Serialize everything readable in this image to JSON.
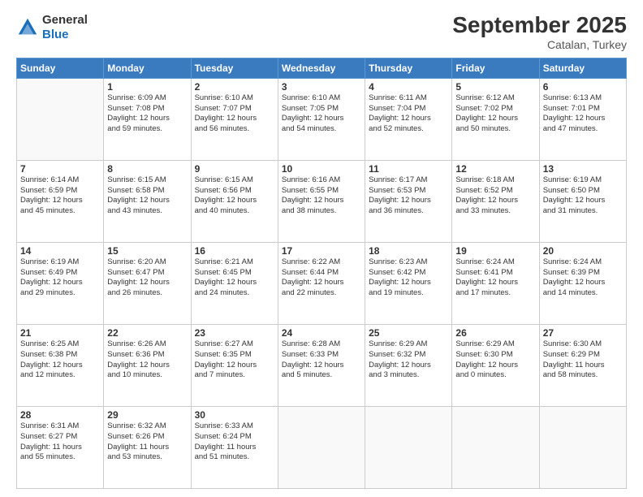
{
  "logo": {
    "general": "General",
    "blue": "Blue"
  },
  "header": {
    "month": "September 2025",
    "location": "Catalan, Turkey"
  },
  "weekdays": [
    "Sunday",
    "Monday",
    "Tuesday",
    "Wednesday",
    "Thursday",
    "Friday",
    "Saturday"
  ],
  "weeks": [
    [
      {
        "day": null,
        "info": null
      },
      {
        "day": "1",
        "info": "Sunrise: 6:09 AM\nSunset: 7:08 PM\nDaylight: 12 hours\nand 59 minutes."
      },
      {
        "day": "2",
        "info": "Sunrise: 6:10 AM\nSunset: 7:07 PM\nDaylight: 12 hours\nand 56 minutes."
      },
      {
        "day": "3",
        "info": "Sunrise: 6:10 AM\nSunset: 7:05 PM\nDaylight: 12 hours\nand 54 minutes."
      },
      {
        "day": "4",
        "info": "Sunrise: 6:11 AM\nSunset: 7:04 PM\nDaylight: 12 hours\nand 52 minutes."
      },
      {
        "day": "5",
        "info": "Sunrise: 6:12 AM\nSunset: 7:02 PM\nDaylight: 12 hours\nand 50 minutes."
      },
      {
        "day": "6",
        "info": "Sunrise: 6:13 AM\nSunset: 7:01 PM\nDaylight: 12 hours\nand 47 minutes."
      }
    ],
    [
      {
        "day": "7",
        "info": "Sunrise: 6:14 AM\nSunset: 6:59 PM\nDaylight: 12 hours\nand 45 minutes."
      },
      {
        "day": "8",
        "info": "Sunrise: 6:15 AM\nSunset: 6:58 PM\nDaylight: 12 hours\nand 43 minutes."
      },
      {
        "day": "9",
        "info": "Sunrise: 6:15 AM\nSunset: 6:56 PM\nDaylight: 12 hours\nand 40 minutes."
      },
      {
        "day": "10",
        "info": "Sunrise: 6:16 AM\nSunset: 6:55 PM\nDaylight: 12 hours\nand 38 minutes."
      },
      {
        "day": "11",
        "info": "Sunrise: 6:17 AM\nSunset: 6:53 PM\nDaylight: 12 hours\nand 36 minutes."
      },
      {
        "day": "12",
        "info": "Sunrise: 6:18 AM\nSunset: 6:52 PM\nDaylight: 12 hours\nand 33 minutes."
      },
      {
        "day": "13",
        "info": "Sunrise: 6:19 AM\nSunset: 6:50 PM\nDaylight: 12 hours\nand 31 minutes."
      }
    ],
    [
      {
        "day": "14",
        "info": "Sunrise: 6:19 AM\nSunset: 6:49 PM\nDaylight: 12 hours\nand 29 minutes."
      },
      {
        "day": "15",
        "info": "Sunrise: 6:20 AM\nSunset: 6:47 PM\nDaylight: 12 hours\nand 26 minutes."
      },
      {
        "day": "16",
        "info": "Sunrise: 6:21 AM\nSunset: 6:45 PM\nDaylight: 12 hours\nand 24 minutes."
      },
      {
        "day": "17",
        "info": "Sunrise: 6:22 AM\nSunset: 6:44 PM\nDaylight: 12 hours\nand 22 minutes."
      },
      {
        "day": "18",
        "info": "Sunrise: 6:23 AM\nSunset: 6:42 PM\nDaylight: 12 hours\nand 19 minutes."
      },
      {
        "day": "19",
        "info": "Sunrise: 6:24 AM\nSunset: 6:41 PM\nDaylight: 12 hours\nand 17 minutes."
      },
      {
        "day": "20",
        "info": "Sunrise: 6:24 AM\nSunset: 6:39 PM\nDaylight: 12 hours\nand 14 minutes."
      }
    ],
    [
      {
        "day": "21",
        "info": "Sunrise: 6:25 AM\nSunset: 6:38 PM\nDaylight: 12 hours\nand 12 minutes."
      },
      {
        "day": "22",
        "info": "Sunrise: 6:26 AM\nSunset: 6:36 PM\nDaylight: 12 hours\nand 10 minutes."
      },
      {
        "day": "23",
        "info": "Sunrise: 6:27 AM\nSunset: 6:35 PM\nDaylight: 12 hours\nand 7 minutes."
      },
      {
        "day": "24",
        "info": "Sunrise: 6:28 AM\nSunset: 6:33 PM\nDaylight: 12 hours\nand 5 minutes."
      },
      {
        "day": "25",
        "info": "Sunrise: 6:29 AM\nSunset: 6:32 PM\nDaylight: 12 hours\nand 3 minutes."
      },
      {
        "day": "26",
        "info": "Sunrise: 6:29 AM\nSunset: 6:30 PM\nDaylight: 12 hours\nand 0 minutes."
      },
      {
        "day": "27",
        "info": "Sunrise: 6:30 AM\nSunset: 6:29 PM\nDaylight: 11 hours\nand 58 minutes."
      }
    ],
    [
      {
        "day": "28",
        "info": "Sunrise: 6:31 AM\nSunset: 6:27 PM\nDaylight: 11 hours\nand 55 minutes."
      },
      {
        "day": "29",
        "info": "Sunrise: 6:32 AM\nSunset: 6:26 PM\nDaylight: 11 hours\nand 53 minutes."
      },
      {
        "day": "30",
        "info": "Sunrise: 6:33 AM\nSunset: 6:24 PM\nDaylight: 11 hours\nand 51 minutes."
      },
      {
        "day": null,
        "info": null
      },
      {
        "day": null,
        "info": null
      },
      {
        "day": null,
        "info": null
      },
      {
        "day": null,
        "info": null
      }
    ]
  ]
}
